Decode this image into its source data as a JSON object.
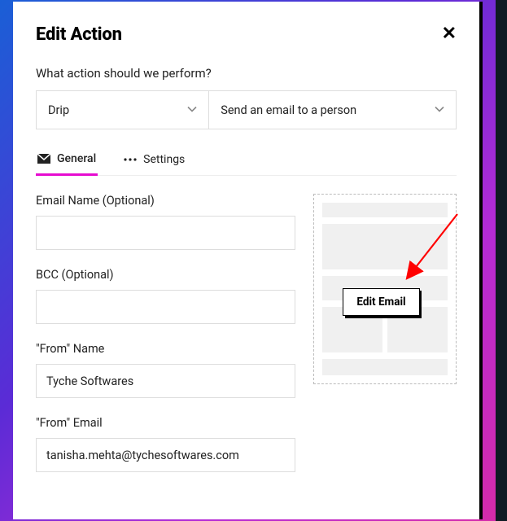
{
  "modal": {
    "title": "Edit Action",
    "close": "✕",
    "question": "What action should we perform?",
    "select_service": "Drip",
    "select_action": "Send an email to a person"
  },
  "tabs": {
    "general": "General",
    "settings": "Settings"
  },
  "fields": {
    "email_name": {
      "label": "Email Name (Optional)",
      "value": ""
    },
    "bcc": {
      "label": "BCC (Optional)",
      "value": ""
    },
    "from_name": {
      "label": "\"From\" Name",
      "value": "Tyche Softwares"
    },
    "from_email": {
      "label": "\"From\" Email",
      "value": "tanisha.mehta@tychesoftwares.com"
    }
  },
  "preview": {
    "edit_button": "Edit Email"
  }
}
